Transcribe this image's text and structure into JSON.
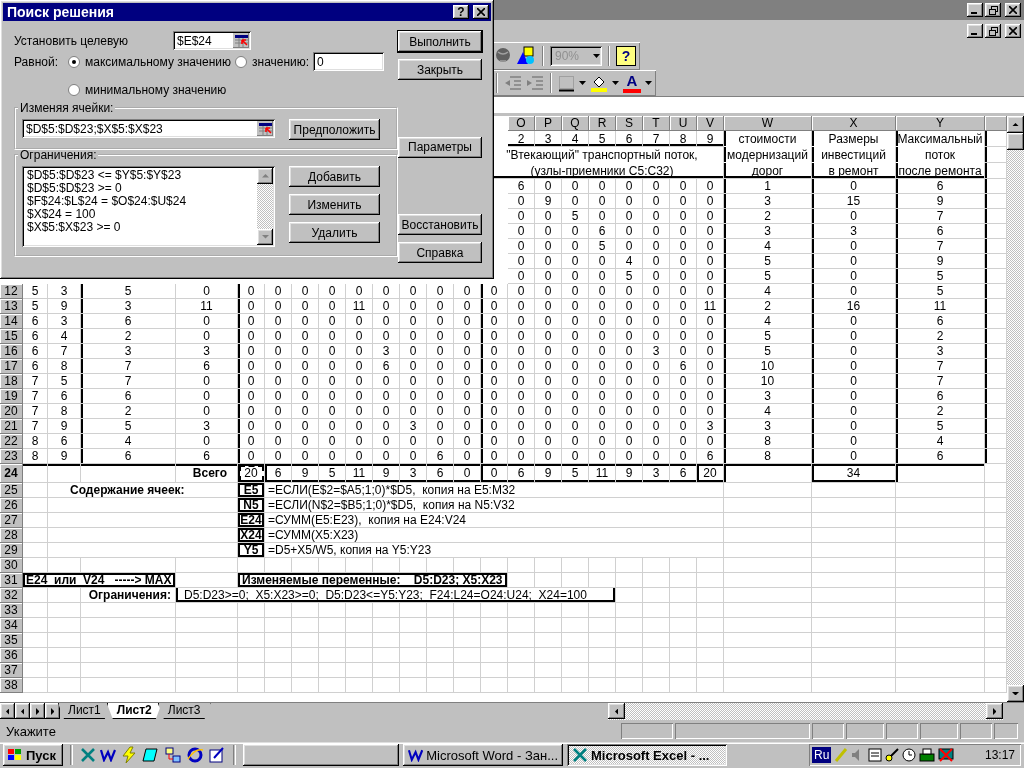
{
  "app": {
    "zoom": "90%",
    "help": "?",
    "font_color_glyph": "A"
  },
  "dialog": {
    "title": "Поиск решения",
    "help": "?",
    "target_label": "Установить целевую",
    "target_value": "$E$24",
    "equal_label": "Равной:",
    "options": [
      {
        "label": "максимальному значению",
        "selected": true
      },
      {
        "label": "значению:",
        "selected": false
      },
      {
        "label": "минимальному значению",
        "selected": false
      }
    ],
    "value_field": "0",
    "changing_label": "Изменяя ячейки:",
    "changing_value": "$D$5:$D$23;$X$5:$X$23",
    "guess_button": "Предположить",
    "constraints_label": "Ограничения:",
    "constraints": [
      "$D$5:$D$23 <= $Y$5:$Y$23",
      "$D$5:$D$23 >= 0",
      "$F$24:$L$24 = $O$24:$U$24",
      "$X$24 = 100",
      "$X$5:$X$23 >= 0"
    ],
    "constraint_buttons": [
      "Добавить",
      "Изменить",
      "Удалить"
    ],
    "button_groups": [
      {
        "buttons": [
          {
            "label": "Выполнить",
            "default": true
          },
          {
            "label": "Закрыть",
            "default": false
          }
        ]
      },
      {
        "buttons": [
          {
            "label": "Параметры",
            "default": false
          }
        ]
      },
      {
        "buttons": [
          {
            "label": "Восстановить",
            "default": false
          },
          {
            "label": "Справка",
            "default": false
          }
        ]
      }
    ]
  },
  "sheet": {
    "columns": [
      "O",
      "P",
      "Q",
      "R",
      "S",
      "T",
      "U",
      "V",
      "W",
      "X",
      "Y"
    ],
    "header": {
      "node_numbers": [
        "2",
        "3",
        "4",
        "5",
        "6",
        "7",
        "8",
        "9"
      ],
      "inflow_title": [
        "\"Втекающий\" транспортный поток,",
        "(узлы-приемники C5:C32)"
      ],
      "cost_title": [
        "стоимости",
        "модернизаций",
        "дорог"
      ],
      "investment_title": [
        "Размеры",
        "инвестиций",
        "в ремонт"
      ],
      "max_flow_title": [
        "Максимальный",
        "поток",
        "после ремонта"
      ]
    },
    "rows": [
      {
        "kind": "data",
        "o_v": [
          "6",
          "0",
          "0",
          "0",
          "0",
          "0",
          "0",
          "0"
        ],
        "cost": "1",
        "investment": "0",
        "max_flow": "6"
      },
      {
        "kind": "data",
        "o_v": [
          "0",
          "9",
          "0",
          "0",
          "0",
          "0",
          "0",
          "0"
        ],
        "cost": "3",
        "investment": "15",
        "max_flow": "9"
      },
      {
        "kind": "data",
        "o_v": [
          "0",
          "0",
          "5",
          "0",
          "0",
          "0",
          "0",
          "0"
        ],
        "cost": "2",
        "investment": "0",
        "max_flow": "7"
      },
      {
        "kind": "data",
        "o_v": [
          "0",
          "0",
          "0",
          "6",
          "0",
          "0",
          "0",
          "0"
        ],
        "cost": "3",
        "investment": "3",
        "max_flow": "6"
      },
      {
        "kind": "data",
        "o_v": [
          "0",
          "0",
          "0",
          "5",
          "0",
          "0",
          "0",
          "0"
        ],
        "cost": "4",
        "investment": "0",
        "max_flow": "7"
      },
      {
        "kind": "data",
        "o_v": [
          "0",
          "0",
          "0",
          "0",
          "4",
          "0",
          "0",
          "0"
        ],
        "cost": "5",
        "investment": "0",
        "max_flow": "9"
      },
      {
        "kind": "data",
        "o_v": [
          "0",
          "0",
          "0",
          "0",
          "5",
          "0",
          "0",
          "0"
        ],
        "cost": "5",
        "investment": "0",
        "max_flow": "5"
      },
      {
        "kind": "data",
        "row": "12",
        "selected": false,
        "a_d": [
          "5",
          "3",
          "5",
          "0"
        ],
        "e_m": [
          "0",
          "0",
          "0",
          "0",
          "0",
          "0",
          "0",
          "0",
          "0"
        ],
        "n_v": [
          "0",
          "0",
          "0",
          "0",
          "0",
          "0",
          "0",
          "0",
          "0"
        ],
        "cost": "4",
        "investment": "0",
        "max_flow": "5"
      },
      {
        "kind": "data",
        "row": "13",
        "selected": false,
        "a_d": [
          "5",
          "9",
          "3",
          "11"
        ],
        "e_m": [
          "0",
          "0",
          "0",
          "0",
          "11",
          "0",
          "0",
          "0",
          "0"
        ],
        "n_v": [
          "0",
          "0",
          "0",
          "0",
          "0",
          "0",
          "0",
          "0",
          "11"
        ],
        "cost": "2",
        "investment": "16",
        "max_flow": "11"
      },
      {
        "kind": "data",
        "row": "14",
        "selected": false,
        "a_d": [
          "6",
          "3",
          "6",
          "0"
        ],
        "e_m": [
          "0",
          "0",
          "0",
          "0",
          "0",
          "0",
          "0",
          "0",
          "0"
        ],
        "n_v": [
          "0",
          "0",
          "0",
          "0",
          "0",
          "0",
          "0",
          "0",
          "0"
        ],
        "cost": "4",
        "investment": "0",
        "max_flow": "6"
      },
      {
        "kind": "data",
        "row": "15",
        "selected": false,
        "a_d": [
          "6",
          "4",
          "2",
          "0"
        ],
        "e_m": [
          "0",
          "0",
          "0",
          "0",
          "0",
          "0",
          "0",
          "0",
          "0"
        ],
        "n_v": [
          "0",
          "0",
          "0",
          "0",
          "0",
          "0",
          "0",
          "0",
          "0"
        ],
        "cost": "5",
        "investment": "0",
        "max_flow": "2"
      },
      {
        "kind": "data",
        "row": "16",
        "selected": false,
        "a_d": [
          "6",
          "7",
          "3",
          "3"
        ],
        "e_m": [
          "0",
          "0",
          "0",
          "0",
          "0",
          "3",
          "0",
          "0",
          "0"
        ],
        "n_v": [
          "0",
          "0",
          "0",
          "0",
          "0",
          "0",
          "3",
          "0",
          "0"
        ],
        "cost": "5",
        "investment": "0",
        "max_flow": "3"
      },
      {
        "kind": "data",
        "row": "17",
        "selected": false,
        "a_d": [
          "6",
          "8",
          "7",
          "6"
        ],
        "e_m": [
          "0",
          "0",
          "0",
          "0",
          "0",
          "6",
          "0",
          "0",
          "0"
        ],
        "n_v": [
          "0",
          "0",
          "0",
          "0",
          "0",
          "0",
          "0",
          "6",
          "0"
        ],
        "cost": "10",
        "investment": "0",
        "max_flow": "7"
      },
      {
        "kind": "data",
        "row": "18",
        "selected": false,
        "a_d": [
          "7",
          "5",
          "7",
          "0"
        ],
        "e_m": [
          "0",
          "0",
          "0",
          "0",
          "0",
          "0",
          "0",
          "0",
          "0"
        ],
        "n_v": [
          "0",
          "0",
          "0",
          "0",
          "0",
          "0",
          "0",
          "0",
          "0"
        ],
        "cost": "10",
        "investment": "0",
        "max_flow": "7"
      },
      {
        "kind": "data",
        "row": "19",
        "selected": false,
        "a_d": [
          "7",
          "6",
          "6",
          "0"
        ],
        "e_m": [
          "0",
          "0",
          "0",
          "0",
          "0",
          "0",
          "0",
          "0",
          "0"
        ],
        "n_v": [
          "0",
          "0",
          "0",
          "0",
          "0",
          "0",
          "0",
          "0",
          "0"
        ],
        "cost": "3",
        "investment": "0",
        "max_flow": "6"
      },
      {
        "kind": "data",
        "row": "20",
        "selected": false,
        "a_d": [
          "7",
          "8",
          "2",
          "0"
        ],
        "e_m": [
          "0",
          "0",
          "0",
          "0",
          "0",
          "0",
          "0",
          "0",
          "0"
        ],
        "n_v": [
          "0",
          "0",
          "0",
          "0",
          "0",
          "0",
          "0",
          "0",
          "0"
        ],
        "cost": "4",
        "investment": "0",
        "max_flow": "2"
      },
      {
        "kind": "data",
        "row": "21",
        "selected": false,
        "a_d": [
          "7",
          "9",
          "5",
          "3"
        ],
        "e_m": [
          "0",
          "0",
          "0",
          "0",
          "0",
          "0",
          "3",
          "0",
          "0"
        ],
        "n_v": [
          "0",
          "0",
          "0",
          "0",
          "0",
          "0",
          "0",
          "0",
          "3"
        ],
        "cost": "3",
        "investment": "0",
        "max_flow": "5"
      },
      {
        "kind": "data",
        "row": "22",
        "selected": false,
        "a_d": [
          "8",
          "6",
          "4",
          "0"
        ],
        "e_m": [
          "0",
          "0",
          "0",
          "0",
          "0",
          "0",
          "0",
          "0",
          "0"
        ],
        "n_v": [
          "0",
          "0",
          "0",
          "0",
          "0",
          "0",
          "0",
          "0",
          "0"
        ],
        "cost": "8",
        "investment": "0",
        "max_flow": "4"
      },
      {
        "kind": "data",
        "row": "23",
        "selected": false,
        "a_d": [
          "8",
          "9",
          "6",
          "6"
        ],
        "e_m": [
          "0",
          "0",
          "0",
          "0",
          "0",
          "0",
          "0",
          "6",
          "0"
        ],
        "n_v": [
          "0",
          "0",
          "0",
          "0",
          "0",
          "0",
          "0",
          "0",
          "6"
        ],
        "cost": "8",
        "investment": "0",
        "max_flow": "6"
      },
      {
        "kind": "total",
        "row": "24",
        "selected": true,
        "total_label": "Всего",
        "marquee": true,
        "e_m": [
          "20",
          "6",
          "9",
          "5",
          "11",
          "9",
          "3",
          "6",
          "0"
        ],
        "n_v": [
          "0",
          "6",
          "9",
          "5",
          "11",
          "9",
          "3",
          "6",
          "20"
        ],
        "investment": "34"
      },
      {
        "kind": "note",
        "row": "25",
        "selected": false,
        "label": "Содержание ячеек:",
        "ref": "E5",
        "formula": "=ЕСЛИ(E$2=$A5;1;0)*$D5,  копия на E5:M32"
      },
      {
        "kind": "note",
        "row": "26",
        "selected": false,
        "ref": "N5",
        "formula": "=ЕСЛИ(N$2=$B5;1;0)*$D5,  копия на N5:V32"
      },
      {
        "kind": "note",
        "row": "27",
        "selected": false,
        "ref": "E24",
        "formula": "=СУММ(E5:E23),  копия на E24:V24"
      },
      {
        "kind": "note",
        "row": "28",
        "selected": false,
        "ref": "X24",
        "formula": "=СУММ(X5:X23)"
      },
      {
        "kind": "note",
        "row": "29",
        "selected": false,
        "ref": "Y5",
        "formula": "=D5+X5/W5, копия на Y5:Y23"
      },
      {
        "kind": "blank",
        "row": "30",
        "selected": false
      },
      {
        "kind": "goal",
        "row": "31",
        "selected": false,
        "objective": "E24  или  V24   -----> MAX",
        "variables": "Изменяемые переменные:    D5:D23; X5:X23"
      },
      {
        "kind": "constraints",
        "row": "32",
        "selected": false,
        "label": "Ограничения:",
        "text": "D5:D23>=0;  X5:X23>=0;  D5:D23<=Y5:Y23;  F24:L24=O24:U24;  X24=100"
      },
      {
        "kind": "blank",
        "row": "33",
        "selected": false
      },
      {
        "kind": "blank",
        "row": "34",
        "selected": false
      },
      {
        "kind": "blank",
        "row": "35",
        "selected": false
      },
      {
        "kind": "blank",
        "row": "36",
        "selected": false
      },
      {
        "kind": "blank",
        "row": "37",
        "selected": false
      },
      {
        "kind": "blank",
        "row": "38",
        "selected": false
      }
    ]
  },
  "sheet_tabs": [
    {
      "label": "Лист1",
      "selected": false
    },
    {
      "label": "Лист2",
      "selected": true
    },
    {
      "label": "Лист3",
      "selected": false
    }
  ],
  "status_bar": {
    "text": "Укажите"
  },
  "taskbar": {
    "start": "Пуск",
    "tasks": [
      {
        "kind": "blank",
        "selected": false
      },
      {
        "kind": "word",
        "label": "Microsoft Word - Зан...",
        "selected": false
      },
      {
        "kind": "excel",
        "label": "Microsoft Excel - ...",
        "selected": true
      }
    ],
    "language": "Ru",
    "clock": "13:17"
  }
}
